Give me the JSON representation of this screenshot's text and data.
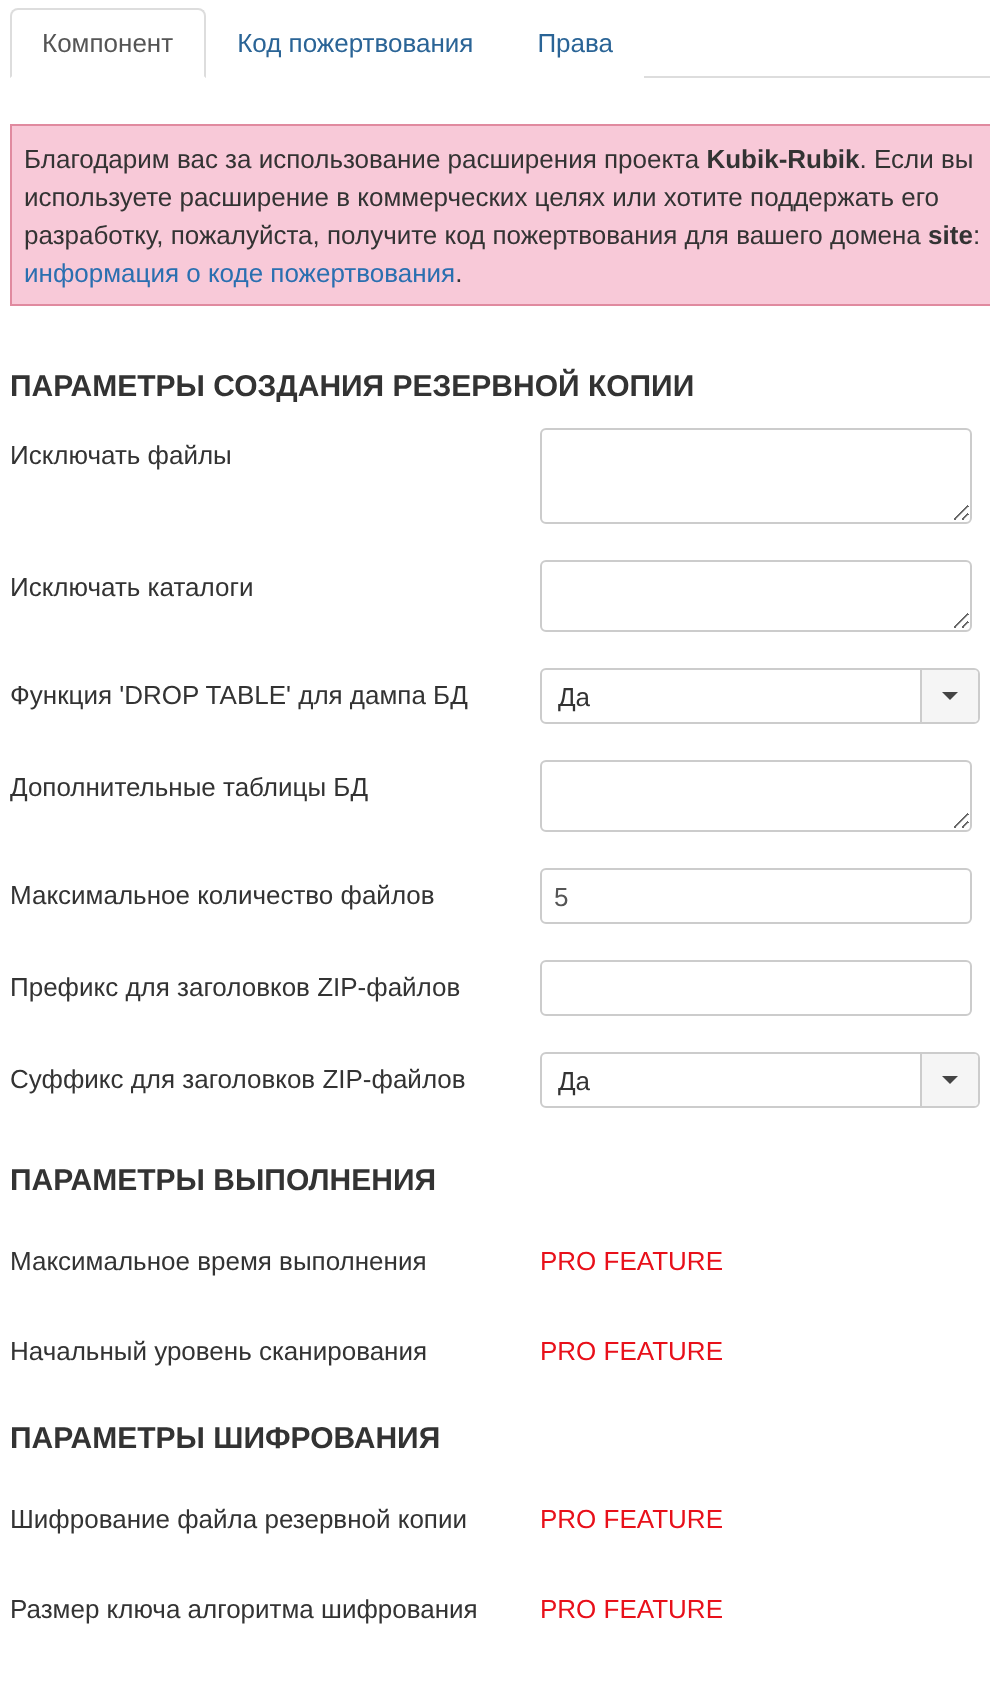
{
  "tabs": [
    {
      "label": "Компонент",
      "selected": true
    },
    {
      "label": "Код пожертвования",
      "selected": false
    },
    {
      "label": "Права",
      "selected": false
    }
  ],
  "alert": {
    "text": "Благодарим вас за использование расширения проекта **Kubik-Rubik**. Если вы используете расширение в коммерческих целях или хотите поддержать его разработку, пожалуйста, получите код пожертвования для вашего домена **site**: ",
    "link": "информация о коде пожертвования",
    "after": "."
  },
  "sections": [
    {
      "title": "ПАРАМЕТРЫ СОЗДАНИЯ РЕЗЕРВНОЙ КОПИИ",
      "fields": [
        {
          "label": "Исключать файлы",
          "kind": "textarea"
        },
        {
          "label": "Исключать каталоги",
          "kind": "textarea"
        },
        {
          "label": "Функция 'DROP TABLE' для дампа БД",
          "kind": "select",
          "value": "Да"
        },
        {
          "label": "Дополнительные таблицы БД",
          "kind": "textarea"
        },
        {
          "label": "Максимальное количество файлов",
          "kind": "text",
          "value": "5"
        },
        {
          "label": "Префикс для заголовков ZIP-файлов",
          "kind": "text"
        },
        {
          "label": "Суффикс для заголовков ZIP-файлов",
          "kind": "select",
          "value": "Да"
        }
      ]
    },
    {
      "title": "ПАРАМЕТРЫ ВЫПОЛНЕНИЯ",
      "fields": [
        {
          "label": "Максимальное время выполнения",
          "kind": "pro",
          "value": "PRO FEATURE"
        },
        {
          "label": "Начальный уровень сканирования",
          "kind": "pro",
          "value": "PRO FEATURE"
        }
      ]
    },
    {
      "title": "ПАРАМЕТРЫ ШИФРОВАНИЯ",
      "fields": [
        {
          "label": "Шифрование файла резервной копии",
          "kind": "pro",
          "value": "PRO FEATURE"
        },
        {
          "label": "Размер ключа алгоритма шифрования",
          "kind": "pro",
          "value": "PRO FEATURE"
        }
      ]
    }
  ]
}
